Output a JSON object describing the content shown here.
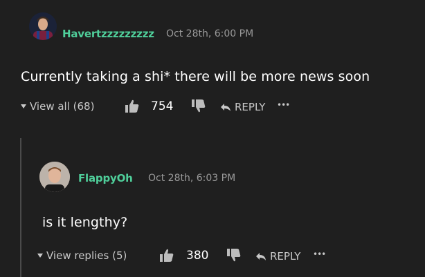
{
  "colors": {
    "background": "#1f1f1f",
    "username": "#4fce9a",
    "muted": "#9a9a9a",
    "text": "#ffffff",
    "thread_line": "#4a4a4a"
  },
  "comment": {
    "username": "Havertzzzzzzzzz",
    "timestamp": "Oct 28th, 6:00 PM",
    "text": "Currently taking a shi* there will be more news soon",
    "view_all_label": "View all (68)",
    "likes": "754",
    "reply_label": "REPLY",
    "more_label": "•••",
    "icons": [
      "caret-down-icon",
      "thumbs-up-icon",
      "thumbs-down-icon",
      "reply-arrow-icon",
      "more-dots-icon"
    ]
  },
  "reply": {
    "username": "FlappyOh",
    "timestamp": "Oct 28th, 6:03 PM",
    "text": "is it lengthy?",
    "view_replies_label": "View replies (5)",
    "likes": "380",
    "reply_label": "REPLY",
    "more_label": "•••"
  }
}
